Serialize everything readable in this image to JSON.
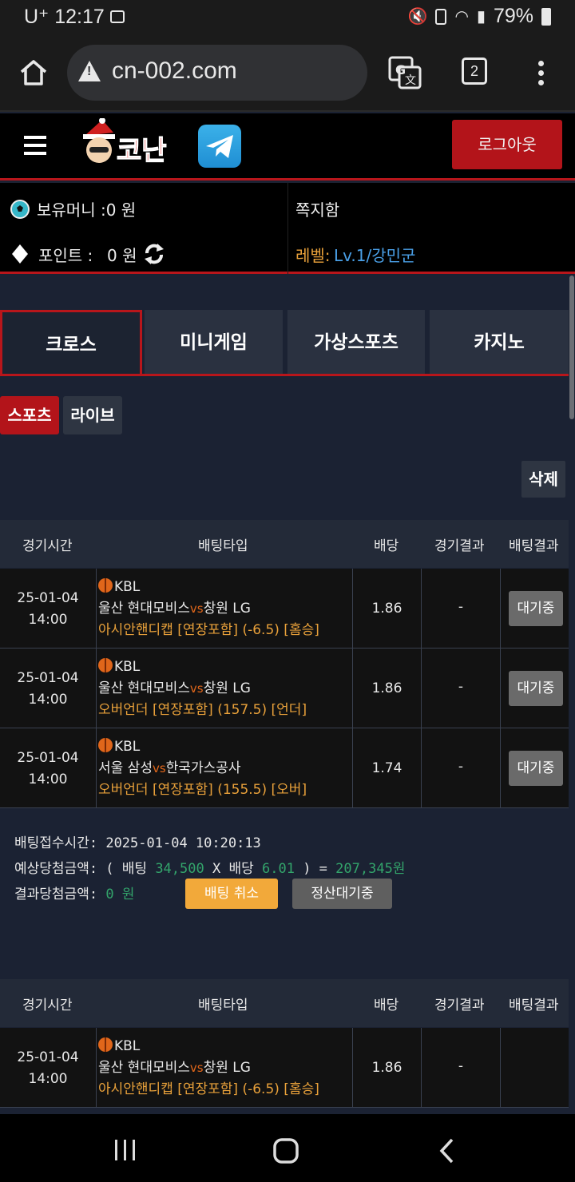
{
  "status_bar": {
    "carrier": "U⁺",
    "time": "12:17",
    "battery": "79%"
  },
  "browser": {
    "url": "cn-002.com",
    "tab_count": "2"
  },
  "header": {
    "logo_text": "코난",
    "logout_label": "로그아웃"
  },
  "account": {
    "money_label": "보유머니 :0 원",
    "inbox_label": "쪽지함",
    "points_label": "포인트 :",
    "points_value": "0 원",
    "level_label": "레벨:",
    "level_value": "Lv.1/강민군"
  },
  "tabs": [
    "크로스",
    "미니게임",
    "가상스포츠",
    "카지노"
  ],
  "subtabs": [
    "스포츠",
    "라이브"
  ],
  "delete_label": "삭제",
  "table_headers": [
    "경기시간",
    "배팅타입",
    "배당",
    "경기결과",
    "배팅결과"
  ],
  "bets": [
    {
      "date": "25-01-04",
      "time": "14:00",
      "league": "KBL",
      "home": "울산 현대모비스",
      "away": "창원 LG",
      "vs": "vs",
      "type": "아시안핸디캡 [연장포함] (-6.5) [홈승]",
      "odds": "1.86",
      "result": "-",
      "status": "대기중"
    },
    {
      "date": "25-01-04",
      "time": "14:00",
      "league": "KBL",
      "home": "울산 현대모비스",
      "away": "창원 LG",
      "vs": "vs",
      "type": "오버언더 [연장포함] (157.5) [언더]",
      "odds": "1.86",
      "result": "-",
      "status": "대기중"
    },
    {
      "date": "25-01-04",
      "time": "14:00",
      "league": "KBL",
      "home": "서울 삼성",
      "away": "한국가스공사",
      "vs": "vs",
      "type": "오버언더 [연장포함] (155.5) [오버]",
      "odds": "1.74",
      "result": "-",
      "status": "대기중"
    }
  ],
  "summary": {
    "received_label": "배팅접수시간:",
    "received_value": "2025-01-04 10:20:13",
    "expected_label": "예상당첨금액: ( 배팅",
    "bet_amount": "34,500",
    "times": "X 배당",
    "total_odds": "6.01",
    "eq": ") =",
    "expected_win": "207,345원",
    "result_label": "결과당첨금액:",
    "result_value": "0 원",
    "cancel_label": "배팅 취소",
    "settle_label": "정산대기중"
  },
  "bets2": [
    {
      "date": "25-01-04",
      "time": "14:00",
      "league": "KBL",
      "home": "울산 현대모비스",
      "away": "창원 LG",
      "vs": "vs",
      "type": "아시안핸디캡 [연장포함] (-6.5) [홈승]",
      "odds": "1.86",
      "result": "-"
    }
  ]
}
